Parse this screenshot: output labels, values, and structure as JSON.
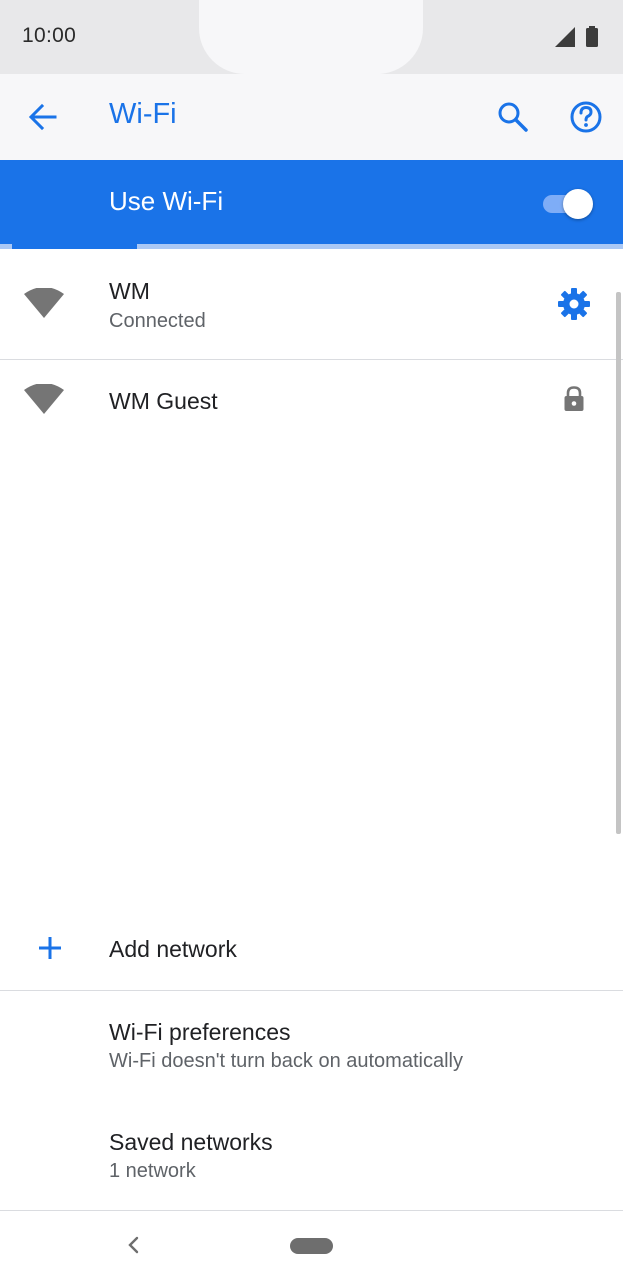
{
  "status_bar": {
    "time": "10:00"
  },
  "app_bar": {
    "title": "Wi-Fi",
    "back_icon": "arrow-back-icon",
    "search_icon": "search-icon",
    "help_icon": "help-circle-icon"
  },
  "wifi_switch": {
    "label": "Use Wi-Fi",
    "enabled": true
  },
  "scan_progress": 0.2,
  "networks": [
    {
      "name": "WM",
      "status": "Connected",
      "action_icon": "gear-icon"
    },
    {
      "name": "WM Guest",
      "status": "",
      "action_icon": "lock-icon"
    }
  ],
  "options": {
    "add_network": "Add network",
    "preferences_title": "Wi-Fi preferences",
    "preferences_summary": "Wi-Fi doesn't turn back on automatically",
    "saved_title": "Saved networks",
    "saved_summary": "1 network"
  },
  "colors": {
    "accent": "#1a73e8",
    "icon_gray": "#757575"
  }
}
